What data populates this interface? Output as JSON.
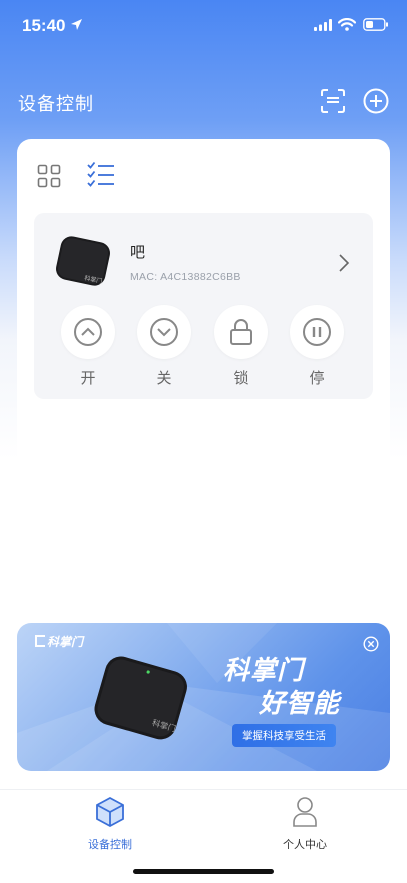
{
  "status_bar": {
    "time": "15:40",
    "icons": [
      "location-arrow-icon",
      "signal-icon",
      "wifi-icon",
      "battery-icon"
    ]
  },
  "header": {
    "title": "设备控制",
    "actions": [
      "scan-icon",
      "add-circle-icon"
    ]
  },
  "view_toggle": {
    "options": [
      "grid-view-icon",
      "list-view-icon"
    ],
    "selected": "list-view-icon"
  },
  "device": {
    "name": "吧",
    "mac": "MAC: A4C13882C6BB",
    "image_label": "科掌门",
    "controls": [
      {
        "label": "开",
        "icon": "chevron-up-circle-icon"
      },
      {
        "label": "关",
        "icon": "chevron-down-circle-icon"
      },
      {
        "label": "锁",
        "icon": "lock-icon"
      },
      {
        "label": "停",
        "icon": "pause-icon"
      }
    ]
  },
  "banner": {
    "logo": "科掌门",
    "device_label": "科掌门",
    "title_line1": "科掌门",
    "title_line2": "好智能",
    "slogan": "掌握科技享受生活"
  },
  "tab_bar": {
    "tabs": [
      {
        "label": "设备控制",
        "icon": "cube-icon",
        "active": true
      },
      {
        "label": "个人中心",
        "icon": "person-icon",
        "active": false
      }
    ]
  },
  "colors": {
    "accent": "#3a6fd8",
    "header_gradient_top": "#4a86f3",
    "card_bg": "#f4f5f8",
    "control_icon": "#888888"
  }
}
